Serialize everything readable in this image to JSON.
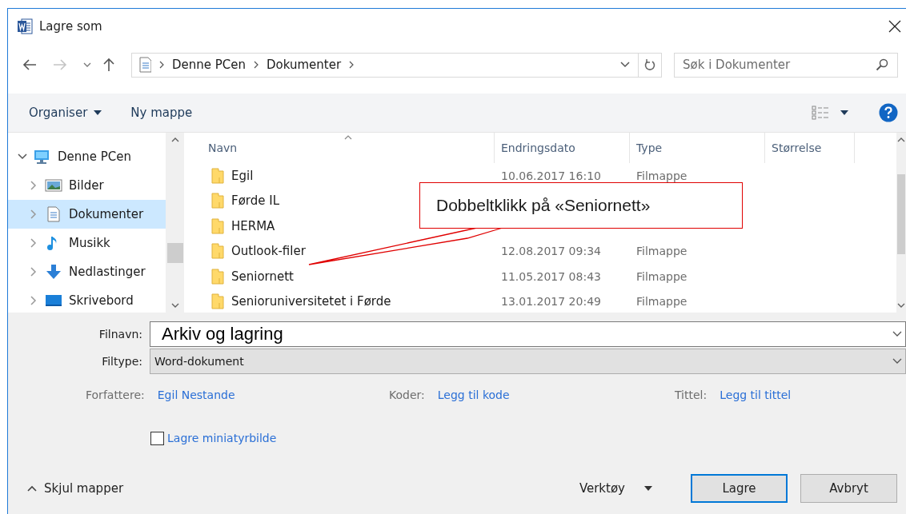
{
  "window": {
    "title": "Lagre som"
  },
  "address": {
    "crumbs": [
      "Denne PCen",
      "Dokumenter"
    ]
  },
  "search": {
    "placeholder": "Søk i Dokumenter"
  },
  "toolbar": {
    "organize": "Organiser",
    "new_folder": "Ny mappe"
  },
  "sidebar": {
    "items": [
      {
        "label": "Denne PCen",
        "kind": "computer",
        "expanded": true,
        "selected": false,
        "children": [
          {
            "label": "Bilder",
            "kind": "pictures",
            "expanded": false,
            "selected": false
          },
          {
            "label": "Dokumenter",
            "kind": "documents",
            "expanded": false,
            "selected": true
          },
          {
            "label": "Musikk",
            "kind": "music",
            "expanded": false,
            "selected": false
          },
          {
            "label": "Nedlastinger",
            "kind": "downloads",
            "expanded": false,
            "selected": false
          },
          {
            "label": "Skrivebord",
            "kind": "desktop",
            "expanded": false,
            "selected": false
          }
        ]
      }
    ]
  },
  "file_list": {
    "columns": [
      "Navn",
      "Endringsdato",
      "Type",
      "Størrelse"
    ],
    "rows": [
      {
        "name": "Egil",
        "date": "10.06.2017 16:10",
        "type": "Filmappe"
      },
      {
        "name": "Førde IL"
      },
      {
        "name": "HERMA"
      },
      {
        "name": "Outlook-filer",
        "date": "12.08.2017 09:34",
        "type": "Filmappe"
      },
      {
        "name": "Seniornett",
        "date": "11.05.2017 08:43",
        "type": "Filmappe"
      },
      {
        "name": "Senioruniversitetet i Førde",
        "date": "13.01.2017 20:49",
        "type": "Filmappe"
      }
    ]
  },
  "callout": {
    "text": "Dobbeltklikk på «Seniornett»"
  },
  "form": {
    "filename": {
      "label": "Filnavn:",
      "value": "Arkiv og lagring"
    },
    "filetype": {
      "label": "Filtype:",
      "value": "Word-dokument"
    },
    "metadata": [
      {
        "label": "Forfattere:",
        "value": "Egil Nestande"
      },
      {
        "label": "Koder:",
        "value": "Legg til kode"
      },
      {
        "label": "Tittel:",
        "value": "Legg til tittel"
      }
    ],
    "thumbnail": {
      "label": "Lagre miniatyrbilde",
      "checked": false
    }
  },
  "footer": {
    "hide_folders": "Skjul mapper",
    "tools": "Verktøy",
    "buttons": [
      {
        "label": "Lagre",
        "default": true
      },
      {
        "label": "Avbryt",
        "default": false
      }
    ]
  }
}
